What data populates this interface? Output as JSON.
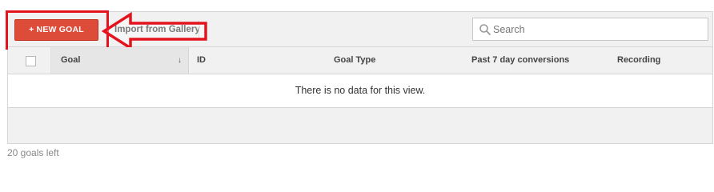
{
  "toolbar": {
    "new_goal_label": "+ NEW GOAL",
    "import_label": "Import from Gallery"
  },
  "search": {
    "placeholder": "Search",
    "value": ""
  },
  "table": {
    "columns": [
      "Goal",
      "ID",
      "Goal Type",
      "Past 7 day conversions",
      "Recording"
    ],
    "sort_indicator": "↓",
    "empty_message": "There is no data for this view."
  },
  "footer": {
    "goals_left": "20 goals left"
  },
  "colors": {
    "primary_button": "#dd4b39",
    "annotation": "#e4141f",
    "toolbar_bg": "#f1f1f1"
  },
  "icons": {
    "search": "search-icon",
    "annotation_arrow": "arrow-left-icon"
  }
}
